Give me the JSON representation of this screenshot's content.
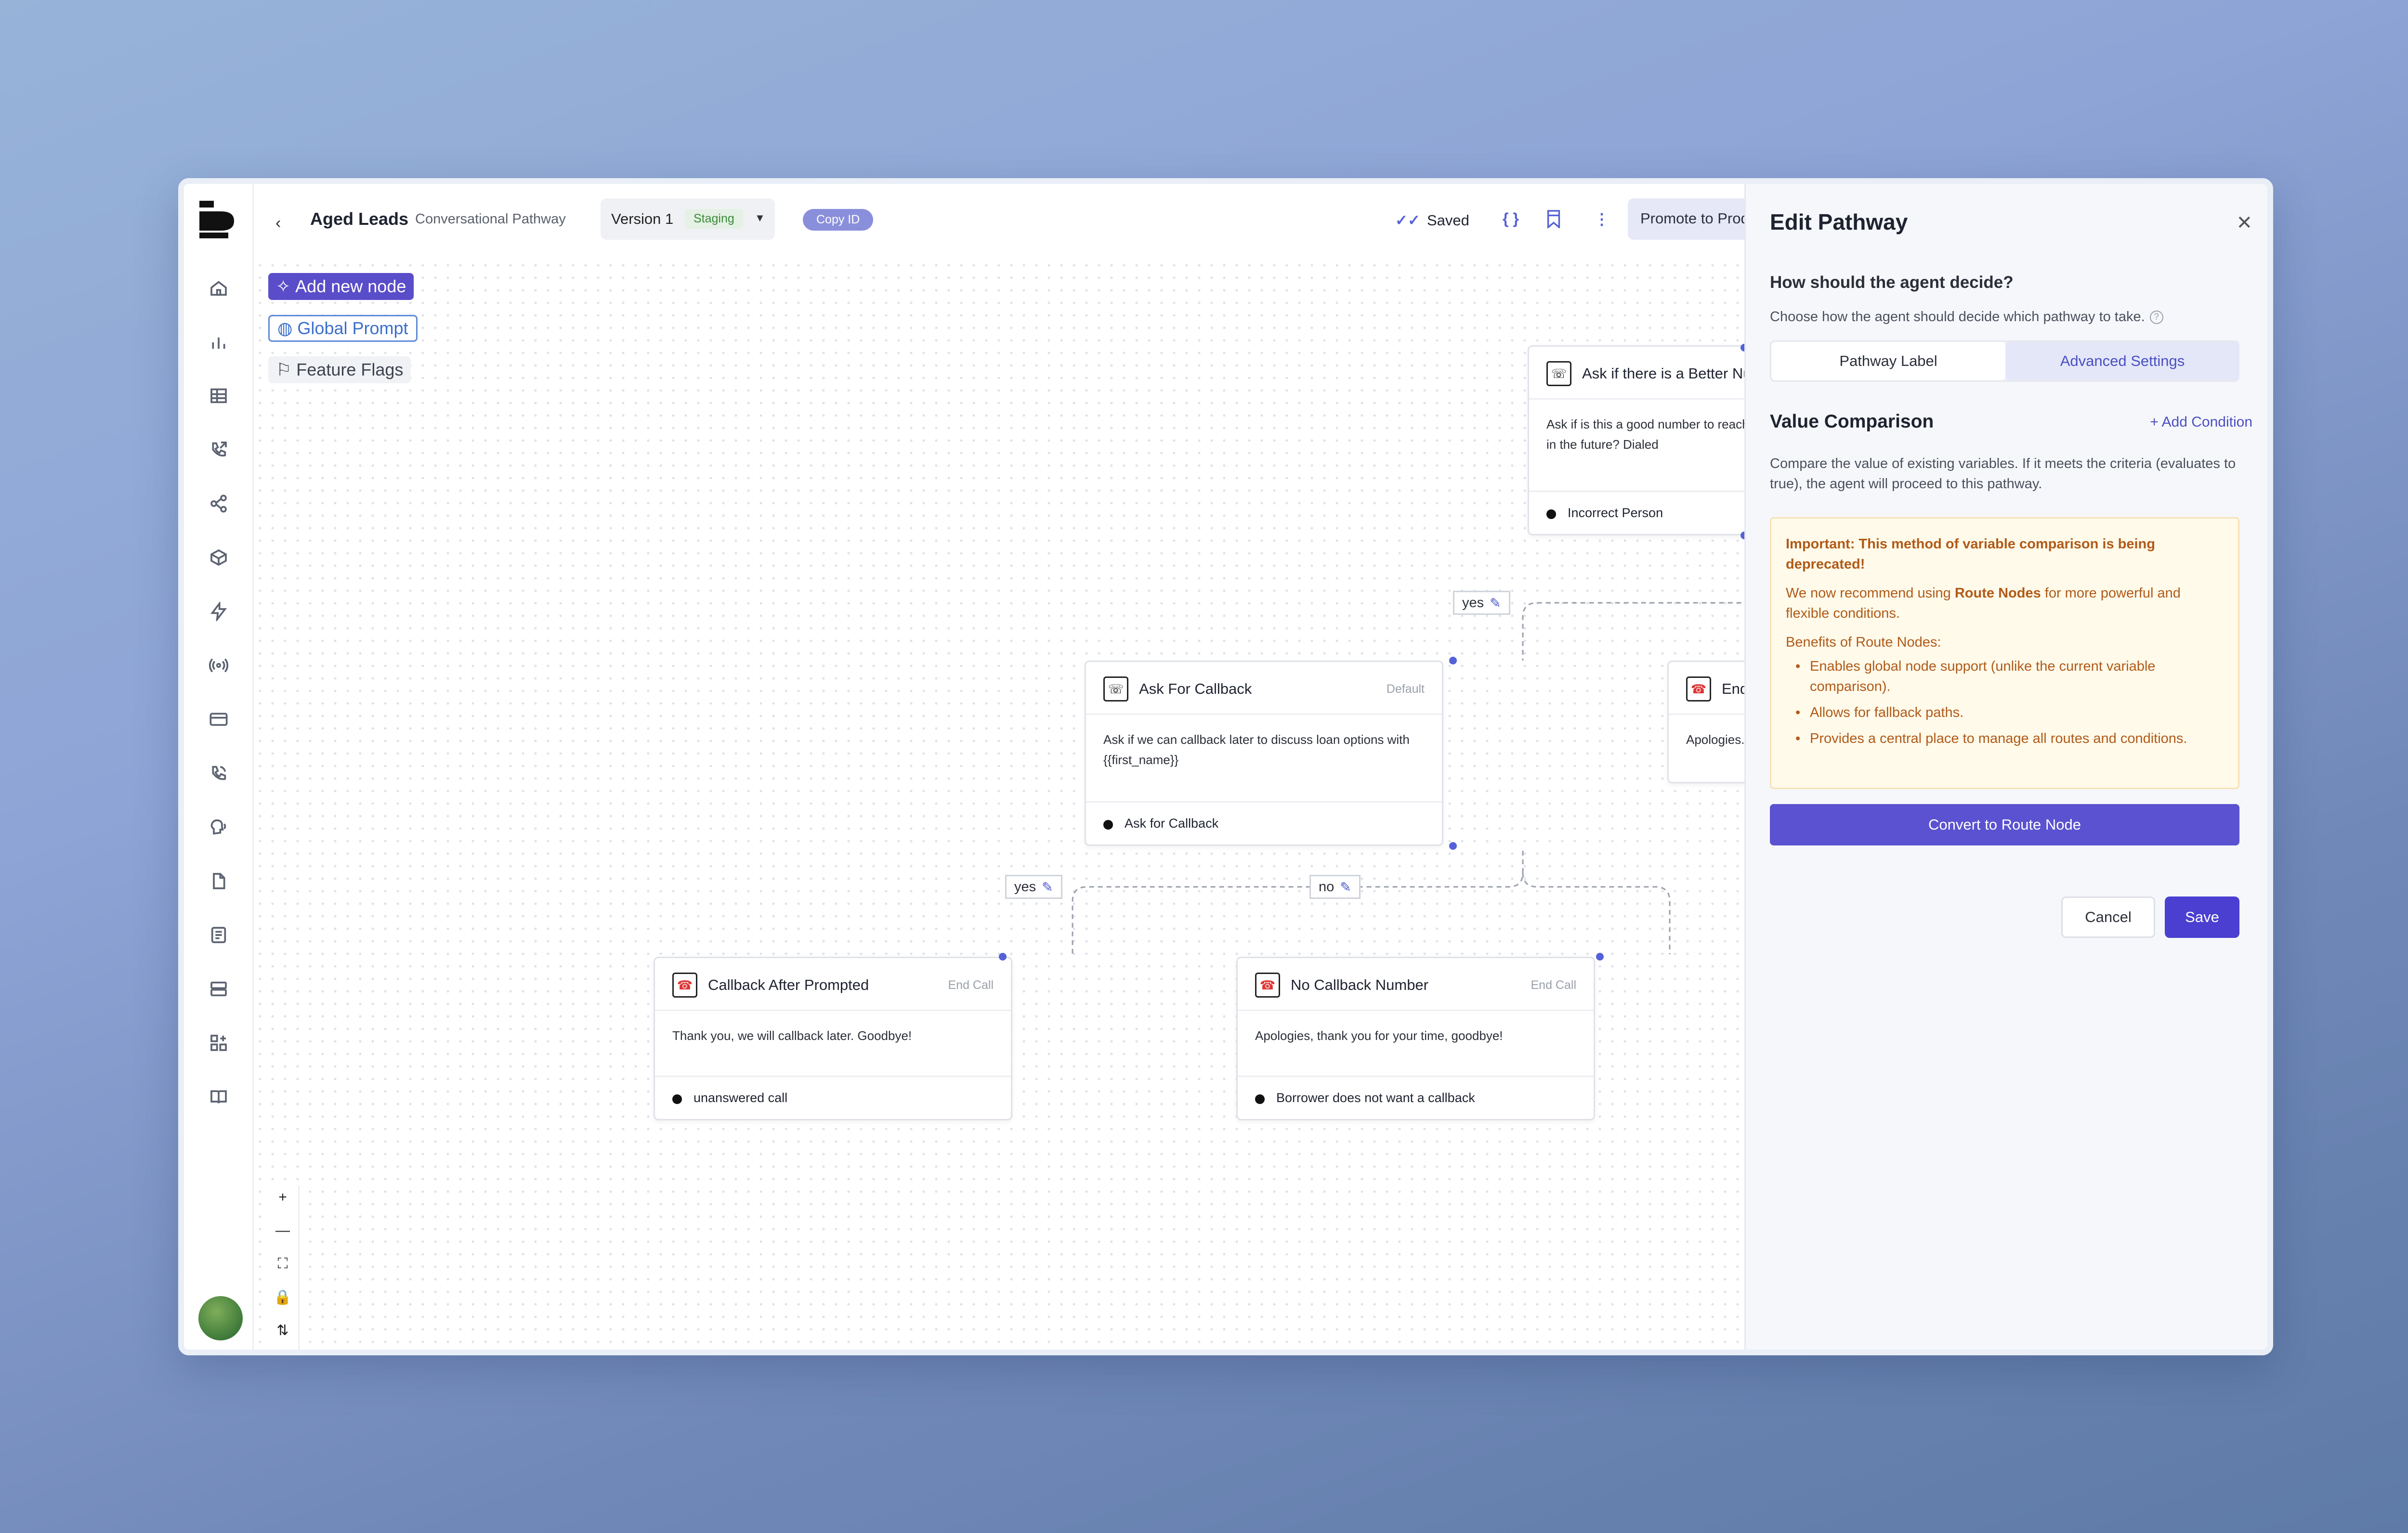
{
  "header": {
    "title": "Aged Leads",
    "subtitle": "Conversational Pathway",
    "version_label": "Version 1",
    "version_badge": "Staging",
    "copy_id": "Copy ID",
    "saved_label": "Saved",
    "promote_label": "Promote to Production"
  },
  "canvas_buttons": {
    "add_node": "Add new node",
    "global_prompt": "Global Prompt",
    "feature_flags": "Feature Flags"
  },
  "nodes": {
    "better_number": {
      "title": "Ask if there is a Better Number",
      "body": "Ask if is this a good number to reach {{first_name}} in the future? Dialed",
      "footer": "Incorrect Person"
    },
    "ask_callback": {
      "title": "Ask For Callback",
      "tag": "Default",
      "body": "Ask if we can callback later to discuss loan options with {{first_name}}",
      "footer": "Ask for Callback"
    },
    "end_partial": {
      "title": "End",
      "body": "Apologies."
    },
    "callback_after": {
      "title": "Callback After Prompted",
      "tag": "End Call",
      "body": "Thank you, we will callback later. Goodbye!",
      "footer": "unanswered call"
    },
    "no_callback": {
      "title": "No Callback Number",
      "tag": "End Call",
      "body": "Apologies, thank you for your time, goodbye!",
      "footer": "Borrower does not want a callback"
    }
  },
  "edges": {
    "yes_top": "yes",
    "yes_left": "yes",
    "no_right": "no"
  },
  "panel": {
    "title": "Edit Pathway",
    "question": "How should the agent decide?",
    "description": "Choose how the agent should decide which pathway to take.",
    "tabs": [
      "Pathway Label",
      "Advanced Settings"
    ],
    "active_tab": "Advanced Settings",
    "section_title": "Value Comparison",
    "add_condition": "Add Condition",
    "section_desc": "Compare the value of existing variables. If it meets the criteria (evaluates to true), the agent will proceed to this pathway.",
    "warning": {
      "title": "Important: This method of variable comparison is being deprecated!",
      "recommend_prefix": "We now recommend using",
      "recommend_bold": "Route Nodes",
      "recommend_suffix": "for more powerful and flexible conditions.",
      "benefits_title": "Benefits of Route Nodes:",
      "benefits": [
        "Enables global node support (unlike the current variable comparison).",
        "Allows for fallback paths.",
        "Provides a central place to manage all routes and conditions."
      ]
    },
    "convert_label": "Convert to Route Node",
    "cancel_label": "Cancel",
    "save_label": "Save"
  },
  "colors": {
    "accent": "#5a52d0",
    "warning_bg": "#fffaea",
    "warning_text": "#b05a18",
    "staging_badge": "#3a8a3a"
  }
}
